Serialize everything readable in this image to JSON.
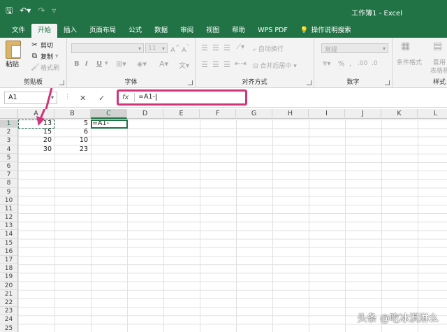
{
  "window": {
    "title": "工作簿1 - Excel"
  },
  "quick_access": {
    "save_icon": "save-icon",
    "undo_icon": "undo-icon",
    "redo_icon": "redo-icon",
    "customize_icon": "customize-icon"
  },
  "tabs": [
    {
      "label": "文件"
    },
    {
      "label": "开始"
    },
    {
      "label": "插入"
    },
    {
      "label": "页面布局"
    },
    {
      "label": "公式"
    },
    {
      "label": "数据"
    },
    {
      "label": "审阅"
    },
    {
      "label": "视图"
    },
    {
      "label": "帮助"
    },
    {
      "label": "WPS PDF"
    },
    {
      "label": "操作说明搜索"
    }
  ],
  "active_tab": "开始",
  "ribbon": {
    "clipboard": {
      "group_label": "剪贴板",
      "paste": "粘贴",
      "cut": "剪切",
      "copy": "复制",
      "format_painter": "格式刷"
    },
    "font": {
      "group_label": "字体",
      "font_size": "11",
      "bold": "B",
      "italic": "I",
      "underline": "U"
    },
    "alignment": {
      "group_label": "对齐方式",
      "wrap_text": "自动换行",
      "merge_center": "合并后居中"
    },
    "number": {
      "group_label": "数字",
      "format": "常规"
    },
    "styles": {
      "group_label": "样式",
      "conditional_format": "条件格式",
      "table_format_1": "套用",
      "table_format_2": "表格格式"
    }
  },
  "formula_bar": {
    "name_box": "A1",
    "cancel_symbol": "✕",
    "enter_symbol": "✓",
    "fx_label": "fx",
    "formula": "=A1-"
  },
  "columns": [
    "A",
    "B",
    "C",
    "D",
    "E",
    "F",
    "G",
    "H",
    "I",
    "J",
    "K",
    "L"
  ],
  "rows": [
    "1",
    "2",
    "3",
    "4",
    "5",
    "6",
    "7",
    "8",
    "9",
    "10",
    "11",
    "12",
    "13",
    "14",
    "15",
    "16",
    "17",
    "18",
    "19",
    "20",
    "21",
    "22",
    "23",
    "24",
    "25"
  ],
  "cells": {
    "A1": "13",
    "B1": "5",
    "C1": "=A1-",
    "A2": "15",
    "B2": "6",
    "A3": "20",
    "B3": "10",
    "A4": "30",
    "B4": "23"
  },
  "watermark": "头条 @吃冰淇淋么",
  "colors": {
    "accent": "#217346",
    "highlight": "#d1357a"
  }
}
